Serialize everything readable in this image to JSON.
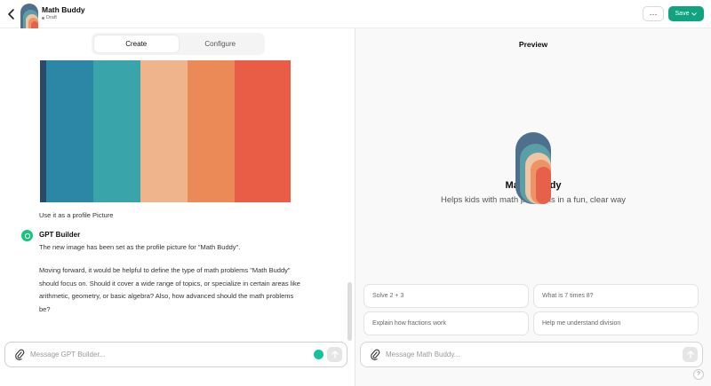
{
  "header": {
    "title": "Math Buddy",
    "status": "Draft",
    "more_label": "···",
    "save_label": "Save"
  },
  "tabs": [
    {
      "label": "Create",
      "active": true
    },
    {
      "label": "Configure",
      "active": false
    }
  ],
  "palette_colors": [
    "#2a4a6b",
    "#2b87a5",
    "#3aa4ab",
    "#f0b48c",
    "#ec8a57",
    "#e95c45"
  ],
  "chat": {
    "user_message": "Use it as a profile Picture",
    "builder_name": "GPT Builder",
    "builder_line1": "The new image has been set as the profile picture for \"Math Buddy\".",
    "builder_line2": "Moving forward, it would be helpful to define the type of math problems \"Math Buddy\" should focus on. Should it cover a wide range of topics, or specialize in certain areas like arithmetic, geometry, or basic algebra? Also, how advanced should the math problems be?"
  },
  "composer": {
    "placeholder": "Message GPT Builder..."
  },
  "preview": {
    "label": "Preview",
    "title": "Math Buddy",
    "subtitle": "Helps kids with math problems in a fun, clear way",
    "starters": [
      "Solve 2 + 3",
      "What is 7 times 8?",
      "Explain how fractions work",
      "Help me understand division"
    ],
    "placeholder": "Message Math Buddy...",
    "help_label": "?"
  }
}
